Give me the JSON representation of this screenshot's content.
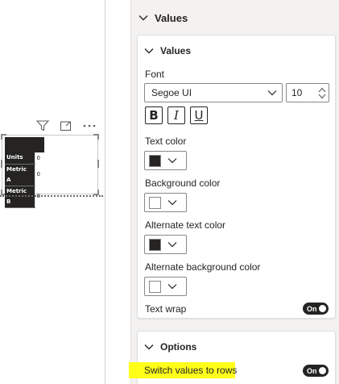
{
  "canvas": {
    "matrix": {
      "rows": [
        {
          "label": "Units",
          "value": "0"
        },
        {
          "label": "Metric A",
          "value": "0"
        },
        {
          "label": "Metric B",
          "value": "0"
        }
      ]
    },
    "header_icons": [
      "filter-icon",
      "focus-mode-icon",
      "more-options-icon"
    ]
  },
  "pane": {
    "section_title": "Values",
    "card_values": {
      "title": "Values",
      "font_label": "Font",
      "font_value": "Segoe UI",
      "font_size": "10",
      "style_buttons": {
        "bold": "B",
        "italic": "I",
        "underline": "U"
      },
      "text_color_label": "Text color",
      "text_color": "#252423",
      "background_color_label": "Background color",
      "background_color": "#ffffff",
      "alt_text_color_label": "Alternate text color",
      "alt_text_color": "#252423",
      "alt_background_color_label": "Alternate background color",
      "alt_background_color": "#ffffff",
      "text_wrap_label": "Text wrap",
      "text_wrap_state": "On"
    },
    "card_options": {
      "title": "Options",
      "switch_values_label": "Switch values to rows",
      "switch_values_state": "On"
    }
  },
  "colors": {
    "accent_dark": "#252423",
    "highlight": "#ffff1a",
    "pane_bg": "#f3f2f1"
  }
}
